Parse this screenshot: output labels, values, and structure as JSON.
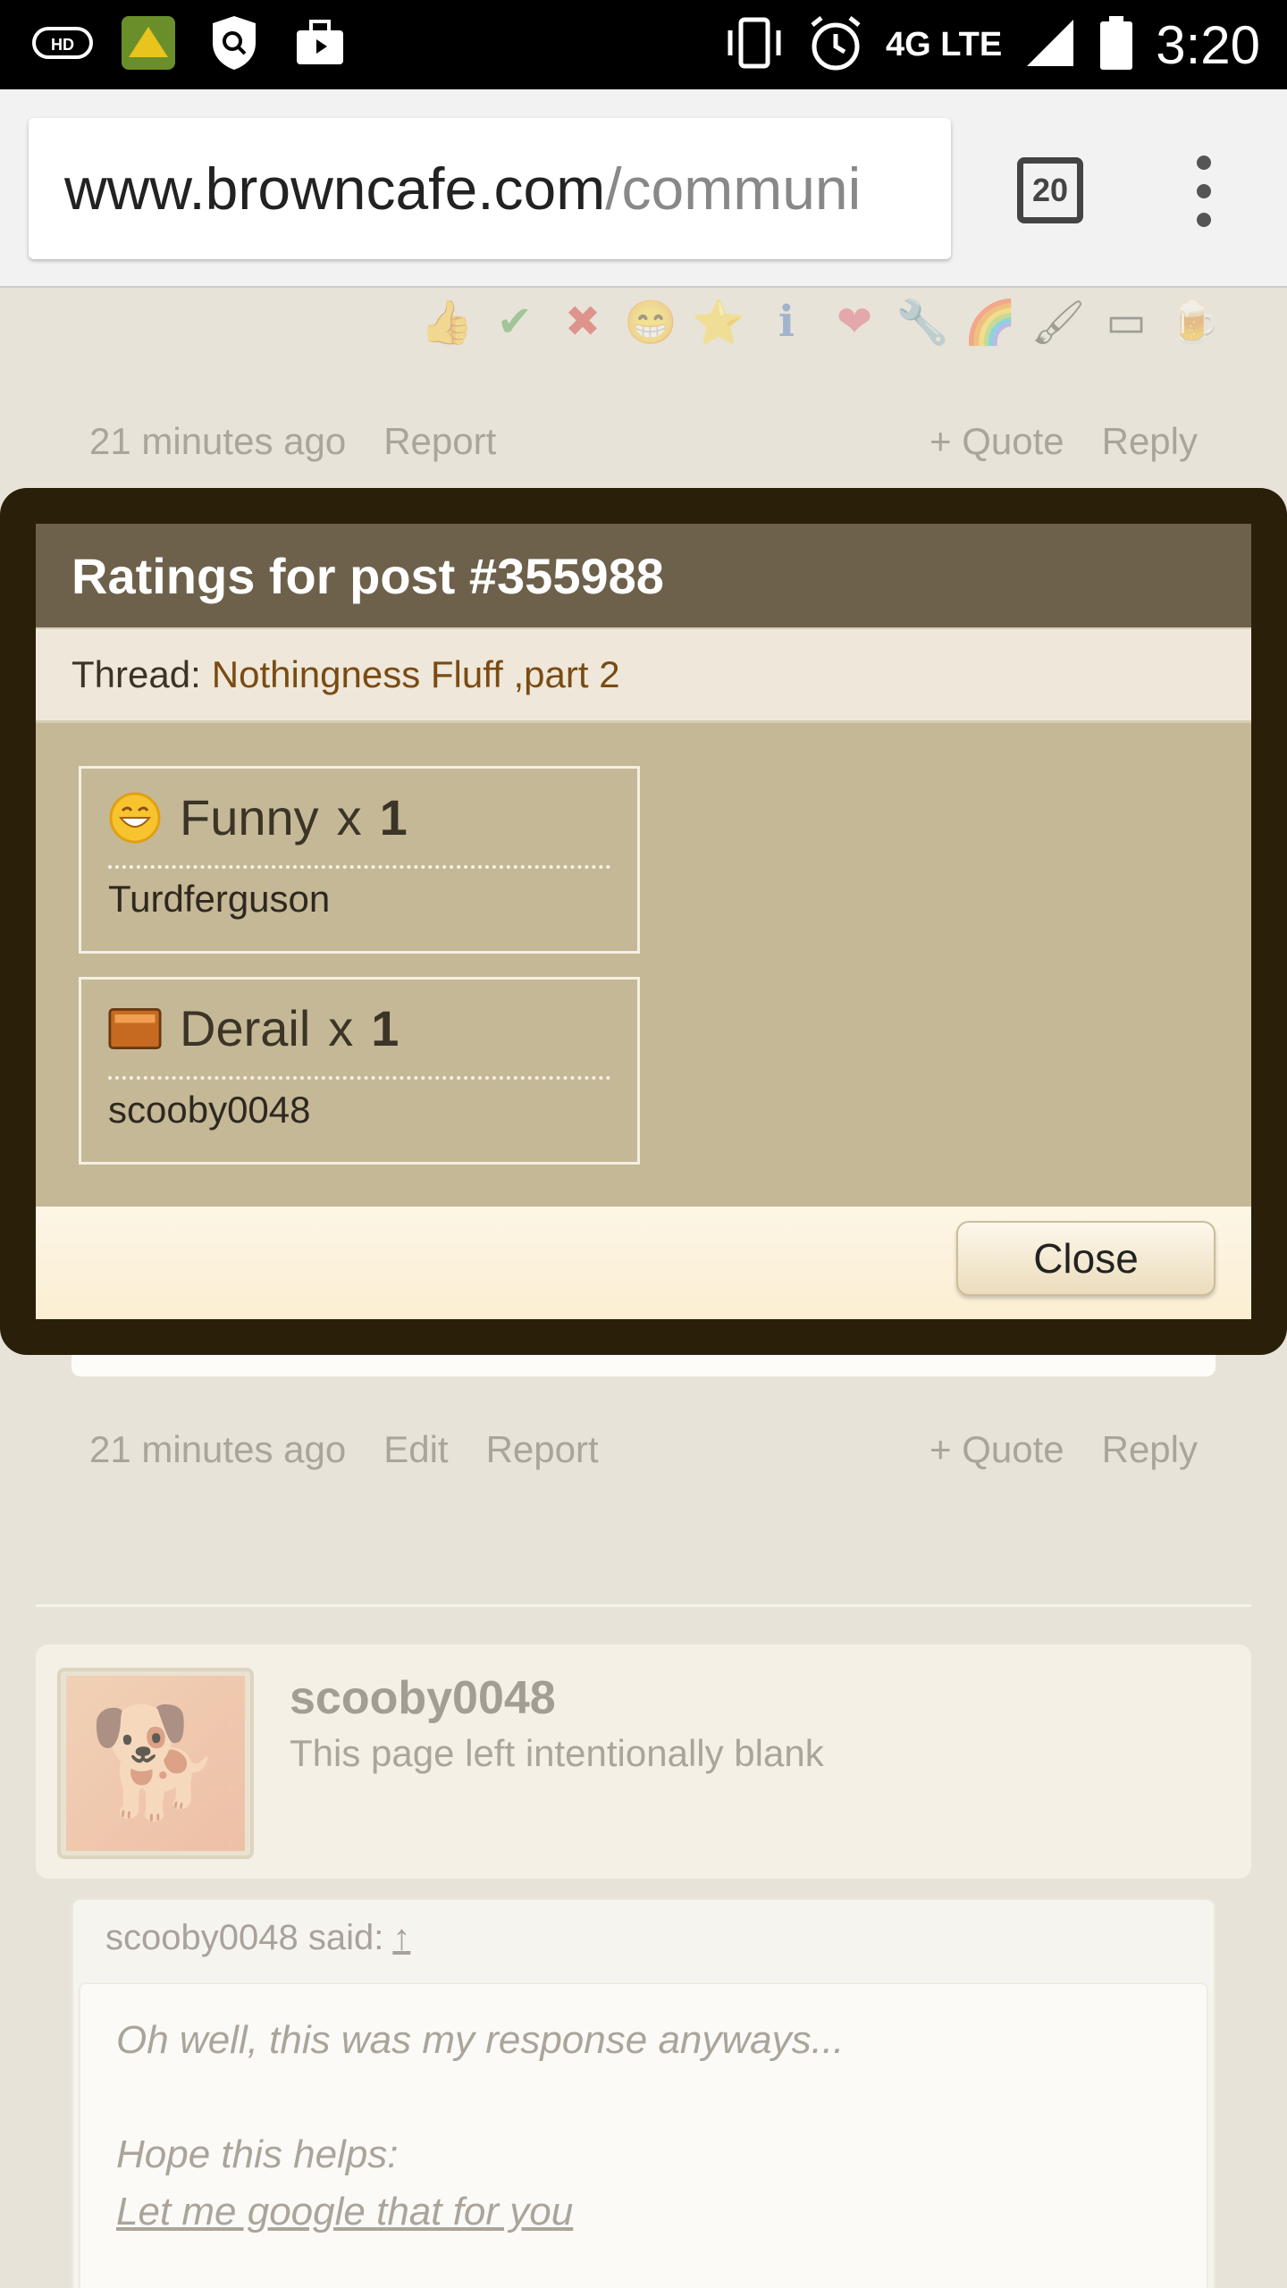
{
  "status_bar": {
    "time": "3:20",
    "network": "4G LTE",
    "icons": [
      "hd-voice-icon",
      "app-icon",
      "shield-icon",
      "briefcase-icon",
      "vibrate-icon",
      "alarm-icon",
      "signal-icon",
      "battery-icon"
    ]
  },
  "browser": {
    "url_host": "www.browncafe.com",
    "url_path": "/communi",
    "tab_count": "20"
  },
  "post_above": {
    "time": "21 minutes ago",
    "report": "Report",
    "quote": "+ Quote",
    "reply": "Reply"
  },
  "post_middle": {
    "time": "21 minutes ago",
    "edit": "Edit",
    "report": "Report",
    "quote": "+ Quote",
    "reply": "Reply"
  },
  "next_post": {
    "username": "scooby0048",
    "user_title": "This page left intentionally blank",
    "quote_attribution": "scooby0048 said:",
    "quote_up": "↑",
    "quote_line1": "Oh well, this was my response anyways...",
    "quote_line2": "Hope this helps:",
    "quote_link": "Let me google that for you"
  },
  "modal": {
    "title": "Ratings for post #355988",
    "thread_label": "Thread:",
    "thread_title": "Nothingness Fluff ,part 2",
    "ratings": [
      {
        "name": "Funny",
        "x": "x",
        "count": "1",
        "user": "Turdferguson",
        "icon": "smiley-icon"
      },
      {
        "name": "Derail",
        "x": "x",
        "count": "1",
        "user": "scooby0048",
        "icon": "derail-icon"
      }
    ],
    "close_label": "Close"
  },
  "colors": {
    "modal_frame": "#2a1f08",
    "modal_header": "#6e614b",
    "modal_body": "#c5b896",
    "thread_link": "#7a4b14"
  }
}
